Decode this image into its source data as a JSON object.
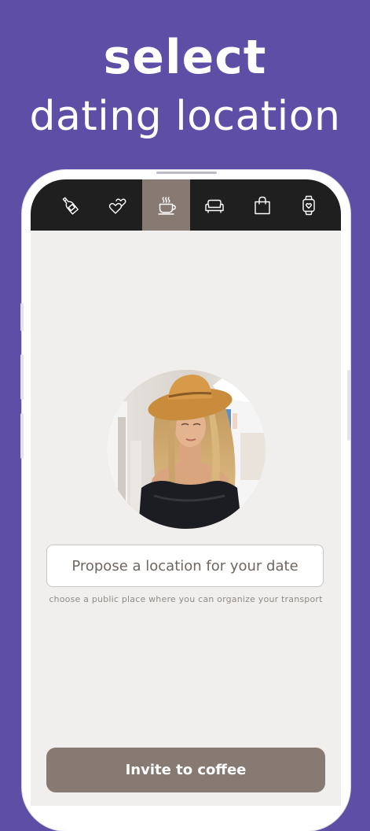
{
  "headline": {
    "bold": "select",
    "light": "dating location"
  },
  "tabs": [
    {
      "icon": "wine-bottle-icon",
      "active": false
    },
    {
      "icon": "hearts-icon",
      "active": false
    },
    {
      "icon": "coffee-cup-icon",
      "active": true
    },
    {
      "icon": "sofa-icon",
      "active": false
    },
    {
      "icon": "shopping-bag-icon",
      "active": false
    },
    {
      "icon": "smartwatch-icon",
      "active": false
    }
  ],
  "location": {
    "placeholder": "Propose a location for your date",
    "value": "",
    "hint": "choose a public place where you can organize your transport"
  },
  "invite_button": {
    "label": "Invite to coffee"
  },
  "colors": {
    "background": "#5e4ea6",
    "tabbar": "#1f1f1f",
    "accent": "#877a72",
    "screen": "#f1efed"
  }
}
